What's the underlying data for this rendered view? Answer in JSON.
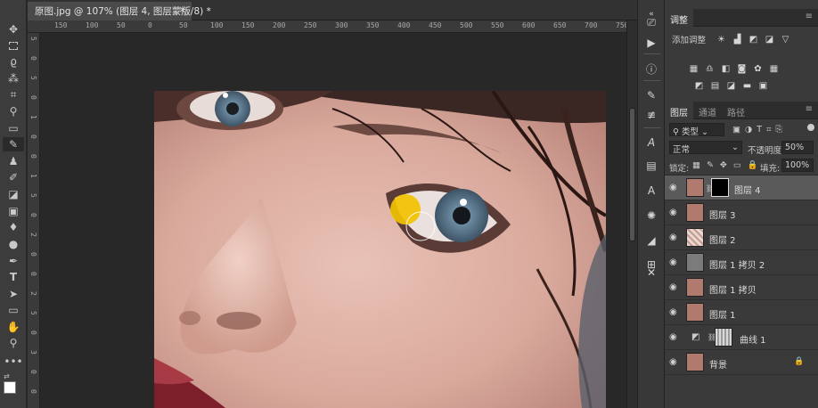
{
  "document": {
    "tab_title": "原图.jpg @ 107% (图层 4, 图层蒙版/8) *",
    "close_glyph": "×",
    "ruler_h": [
      "150",
      "100",
      "50",
      "0",
      "50",
      "100",
      "150",
      "200",
      "250",
      "300",
      "350",
      "400",
      "450",
      "500",
      "550",
      "600",
      "650",
      "700",
      "750"
    ],
    "ruler_v": [
      "5",
      "0",
      "5",
      "0",
      "1",
      "0",
      "0",
      "1",
      "5",
      "0",
      "2",
      "0",
      "0",
      "2",
      "5",
      "0",
      "3",
      "0",
      "0"
    ]
  },
  "tools": [
    "move-icon",
    "marquee-icon",
    "lasso-icon",
    "magic-wand-icon",
    "crop-icon",
    "eyedropper-icon",
    "healing-icon",
    "brush-icon",
    "stamp-icon",
    "history-brush-icon",
    "eraser-icon",
    "gradient-icon",
    "blur-icon",
    "dodge-icon",
    "pen-icon",
    "type-icon",
    "path-select-icon",
    "shape-icon",
    "hand-icon",
    "zoom-icon",
    "more-icon"
  ],
  "adjustments": {
    "tab": "调整",
    "add_label": "添加调整"
  },
  "layers_panel": {
    "tabs": [
      "图层",
      "通道",
      "路径"
    ],
    "filter_kind": "类型",
    "blend_mode": "正常",
    "opacity_label": "不透明度:",
    "opacity_value": "50%",
    "lock_label": "锁定:",
    "fill_label": "填充:",
    "fill_value": "100%",
    "layers": [
      {
        "name": "图层 4",
        "selected": true
      },
      {
        "name": "图层 3",
        "selected": false
      },
      {
        "name": "图层 2",
        "selected": false
      },
      {
        "name": "图层 1 拷贝 2",
        "selected": false
      },
      {
        "name": "图层 1 拷贝",
        "selected": false
      },
      {
        "name": "图层 1",
        "selected": false
      },
      {
        "name": "曲线 1",
        "selected": false
      },
      {
        "name": "背景",
        "selected": false
      }
    ]
  },
  "colors": {
    "cursor_highlight": "#f2c200",
    "panel_bg": "#3a3a3a",
    "selected_layer": "#5a5a5a"
  }
}
